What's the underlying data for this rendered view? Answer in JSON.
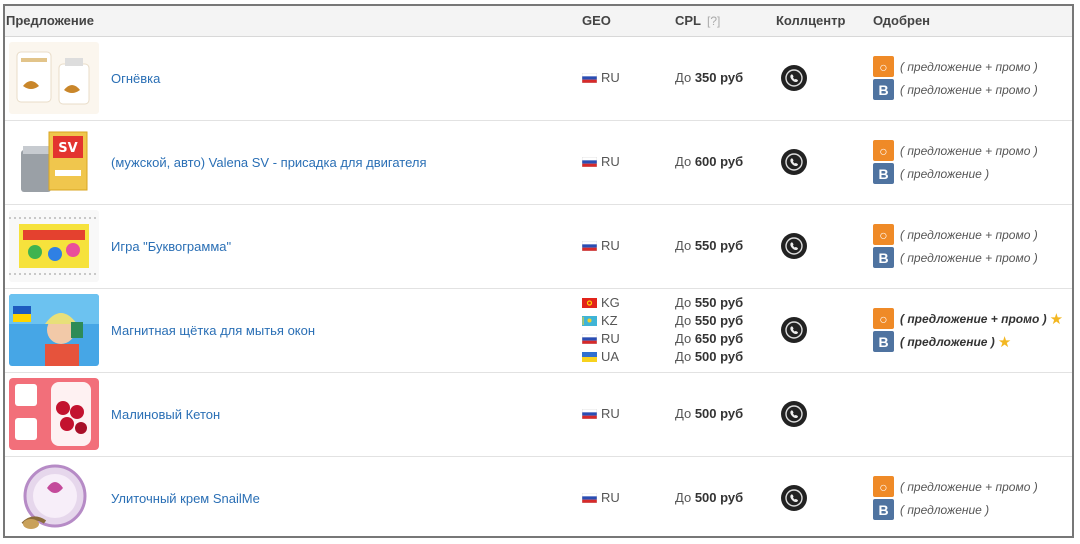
{
  "headers": {
    "offer": "Предложение",
    "geo": "GEO",
    "cpl": "CPL",
    "cpl_hint": "[?]",
    "callcenter": "Коллцентр",
    "approved": "Одобрен"
  },
  "rows": [
    {
      "name": "Огнёвка",
      "geo": [
        {
          "code": "RU",
          "flag": "ru"
        }
      ],
      "cpl": [
        {
          "prefix": "До",
          "amount": "350 руб"
        }
      ],
      "approved": [
        {
          "network": "ok",
          "text": "( предложение + промо )",
          "bold": false,
          "star": false
        },
        {
          "network": "vk",
          "text": "( предложение + промо )",
          "bold": false,
          "star": false
        }
      ]
    },
    {
      "name": "(мужской, авто) Valena SV - присадка для двигателя",
      "geo": [
        {
          "code": "RU",
          "flag": "ru"
        }
      ],
      "cpl": [
        {
          "prefix": "До",
          "amount": "600 руб"
        }
      ],
      "approved": [
        {
          "network": "ok",
          "text": "( предложение + промо )",
          "bold": false,
          "star": false
        },
        {
          "network": "vk",
          "text": "( предложение )",
          "bold": false,
          "star": false
        }
      ]
    },
    {
      "name": "Игра \"Буквограмма\"",
      "geo": [
        {
          "code": "RU",
          "flag": "ru"
        }
      ],
      "cpl": [
        {
          "prefix": "До",
          "amount": "550 руб"
        }
      ],
      "approved": [
        {
          "network": "ok",
          "text": "( предложение + промо )",
          "bold": false,
          "star": false
        },
        {
          "network": "vk",
          "text": "( предложение + промо )",
          "bold": false,
          "star": false
        }
      ]
    },
    {
      "name": "Магнитная щётка для мытья окон",
      "geo": [
        {
          "code": "KG",
          "flag": "kg"
        },
        {
          "code": "KZ",
          "flag": "kz"
        },
        {
          "code": "RU",
          "flag": "ru"
        },
        {
          "code": "UA",
          "flag": "ua"
        }
      ],
      "cpl": [
        {
          "prefix": "До",
          "amount": "550 руб"
        },
        {
          "prefix": "До",
          "amount": "550 руб"
        },
        {
          "prefix": "До",
          "amount": "650 руб"
        },
        {
          "prefix": "До",
          "amount": "500 руб"
        }
      ],
      "approved": [
        {
          "network": "ok",
          "text": "( предложение + промо )",
          "bold": true,
          "star": true
        },
        {
          "network": "vk",
          "text": "( предложение )",
          "bold": true,
          "star": true
        }
      ]
    },
    {
      "name": "Малиновый Кетон",
      "geo": [
        {
          "code": "RU",
          "flag": "ru"
        }
      ],
      "cpl": [
        {
          "prefix": "До",
          "amount": "500 руб"
        }
      ],
      "approved": []
    },
    {
      "name": "Улиточный крем SnailMe",
      "geo": [
        {
          "code": "RU",
          "flag": "ru"
        }
      ],
      "cpl": [
        {
          "prefix": "До",
          "amount": "500 руб"
        }
      ],
      "approved": [
        {
          "network": "ok",
          "text": "( предложение + промо )",
          "bold": false,
          "star": false
        },
        {
          "network": "vk",
          "text": "( предложение )",
          "bold": false,
          "star": false
        }
      ]
    }
  ],
  "icons": {
    "ok": "odnoklassniki-icon",
    "vk": "vkontakte-icon",
    "callcenter": "phone-icon",
    "star": "star-icon"
  },
  "colors": {
    "link": "#2a6fb5",
    "ok": "#ef8a27",
    "vk": "#4f73a0",
    "star": "#f3b721"
  }
}
